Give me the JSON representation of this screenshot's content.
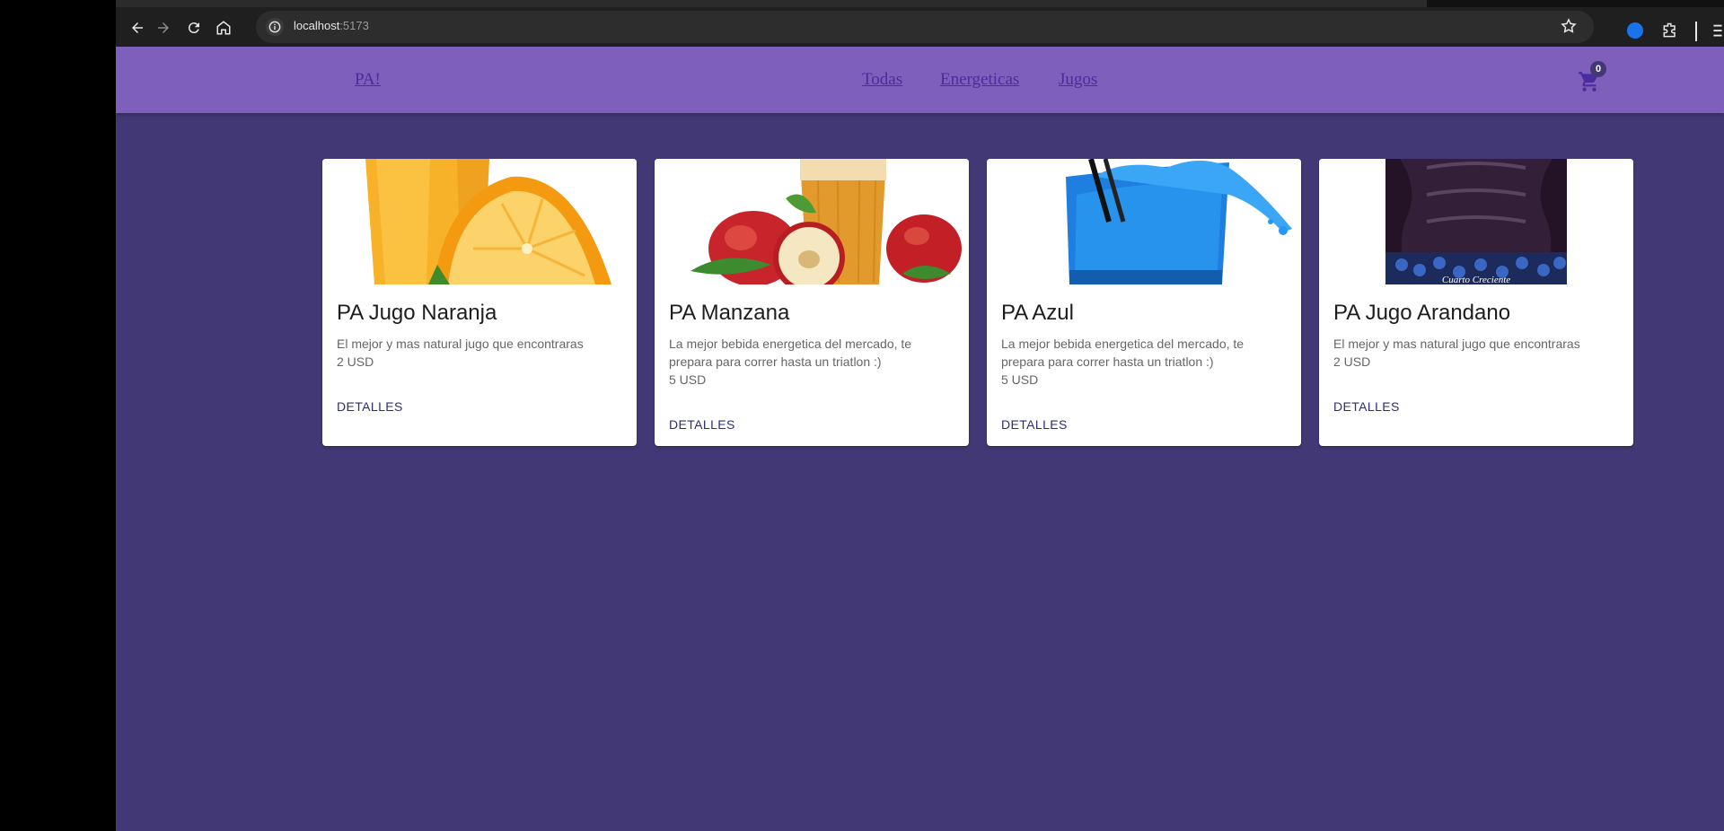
{
  "browser": {
    "url_host": "localhost",
    "url_port": ":5173"
  },
  "app": {
    "brand": "PA!",
    "nav": [
      {
        "label": "Todas"
      },
      {
        "label": "Energeticas"
      },
      {
        "label": "Jugos"
      }
    ],
    "cart_count": "0"
  },
  "products": [
    {
      "title": "PA Jugo Naranja",
      "description": "El mejor y mas natural jugo que encontraras",
      "price": "2 USD",
      "button": "DETALLES",
      "image": "orange-juice-image"
    },
    {
      "title": "PA Manzana",
      "description": "La mejor bebida energetica del mercado, te prepara para correr hasta un triatlon :)",
      "price": "5 USD",
      "button": "DETALLES",
      "image": "apple-drink-image"
    },
    {
      "title": "PA Azul",
      "description": "La mejor bebida energetica del mercado, te prepara para correr hasta un triatlon :)",
      "price": "5 USD",
      "button": "DETALLES",
      "image": "blue-drink-image"
    },
    {
      "title": "PA Jugo Arandano",
      "description": "El mejor y mas natural jugo que encontraras",
      "price": "2 USD",
      "button": "DETALLES",
      "image": "blueberry-jar-image",
      "image_label": "Cuarto Creciente"
    }
  ],
  "colors": {
    "page_bg": "#423876",
    "appbar_bg": "#7e60bc",
    "link": "#4b2b9e"
  }
}
